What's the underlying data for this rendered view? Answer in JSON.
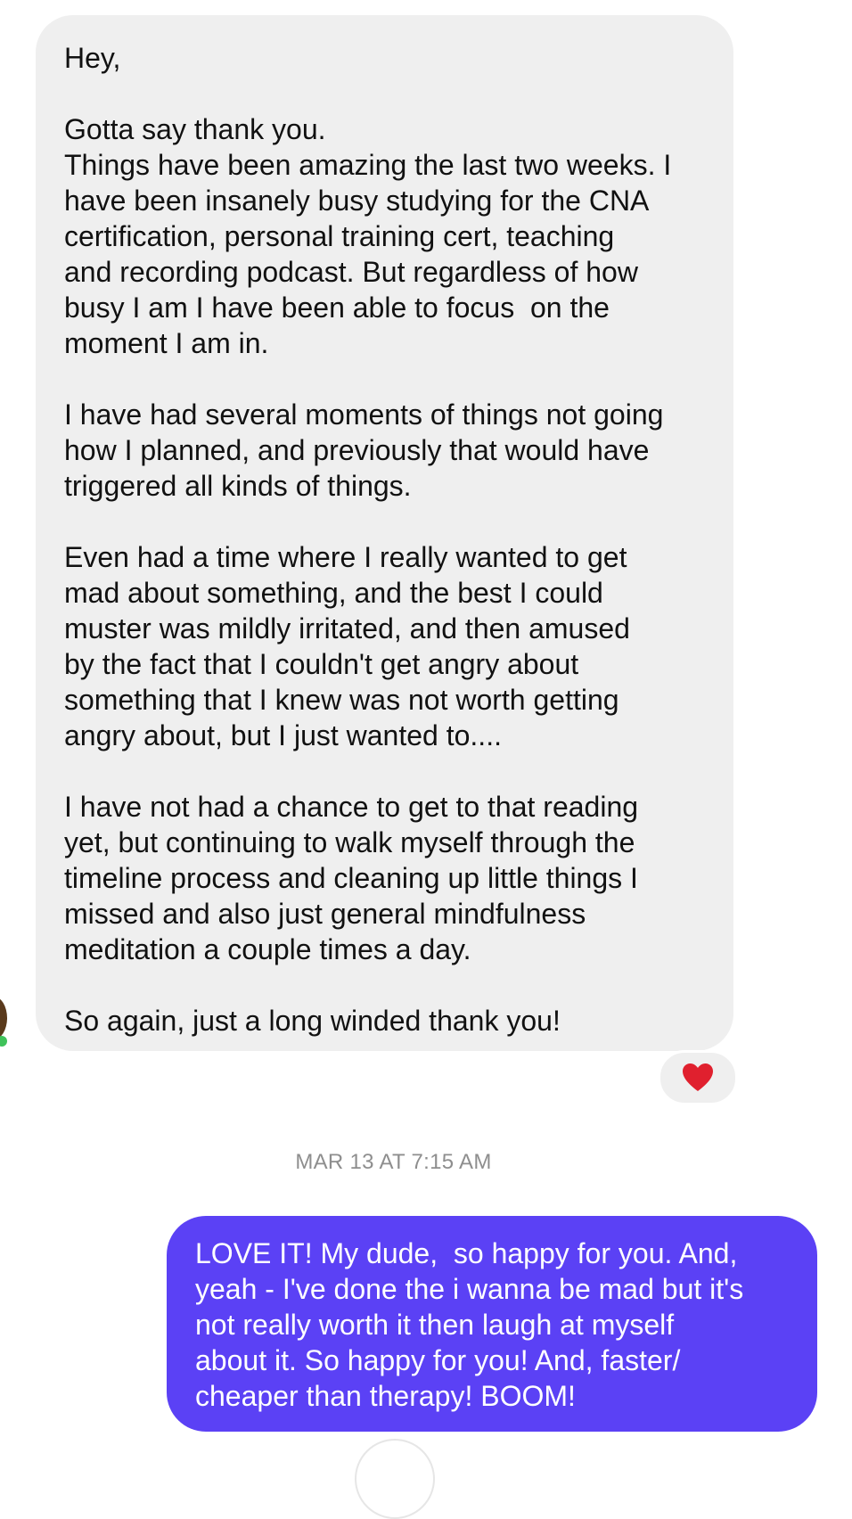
{
  "incoming_message": {
    "lines": [
      "Hey,",
      "",
      "Gotta say thank you.",
      "Things have been amazing the last two weeks. I",
      "have been insanely busy studying for the CNA",
      "certification, personal training cert, teaching",
      "and recording podcast. But regardless of how",
      "busy I am I have been able to focus  on the",
      "moment I am in.",
      "",
      "I have had several moments of things not going",
      "how I planned, and previously that would have",
      "triggered all kinds of things.",
      "",
      "Even had a time where I really wanted to get",
      "mad about something, and the best I could",
      "muster was mildly irritated, and then amused",
      "by the fact that I couldn't get angry about",
      "something that I knew was not worth getting",
      "angry about, but I just wanted to....",
      "",
      "I have not had a chance to get to that reading",
      "yet, but continuing to walk myself through the",
      "timeline process and cleaning up little things I",
      "missed and also just general mindfulness",
      "meditation a couple times a day.",
      "",
      "So again, just a long winded thank you!"
    ],
    "reaction": {
      "icon": "heart-icon",
      "color": "#e0202e"
    }
  },
  "timestamp": "MAR 13 AT 7:15 AM",
  "outgoing_message": {
    "lines": [
      "LOVE IT! My dude,  so happy for you. And,",
      "yeah - I've done the i wanna be mad but it's",
      "not really worth it then laugh at myself",
      "about it. So happy for you! And, faster/",
      "cheaper than therapy! BOOM!"
    ],
    "bubble_color": "#5b41f5"
  },
  "colors": {
    "incoming_bubble": "#efefef",
    "timestamp_text": "#8e8e8e",
    "online_status": "#3fc25a"
  }
}
